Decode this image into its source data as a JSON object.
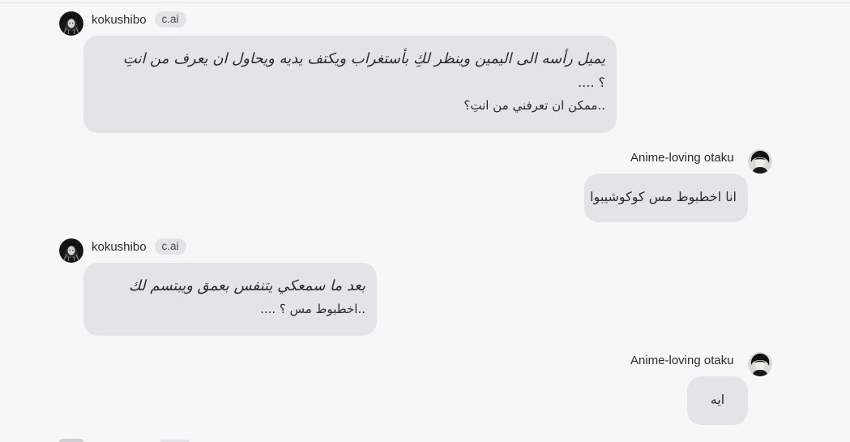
{
  "messages": [
    {
      "sender": "kokushibo",
      "badge": "c.ai",
      "lines": [
        "يميل رأسه الى اليمين وينظر لكِ بأستغراب ويكتف يديه ويحاول ان يعرف من انتِ",
        "؟ ....",
        "..ممكن ان تعرفني من انتِ؟"
      ]
    },
    {
      "sender": "Anime-loving otaku",
      "lines": [
        "انا اخطبوط مس كوكوشيبوا"
      ]
    },
    {
      "sender": "kokushibo",
      "badge": "c.ai",
      "lines": [
        "بعد ما سمعكي يتنفس بعمق ويبتسم لك",
        "..اخطبوط مس ؟ ...."
      ]
    },
    {
      "sender": "Anime-loving otaku",
      "lines": [
        "ايه"
      ]
    }
  ],
  "icons": {
    "bot_avatar": "kokushibo-avatar-icon",
    "user_avatar": "user-avatar-icon"
  },
  "colors": {
    "background": "#f7f7f8",
    "bubble": "#e3e3e8",
    "badge": "#e3e3e8",
    "text": "#2b2b31"
  }
}
